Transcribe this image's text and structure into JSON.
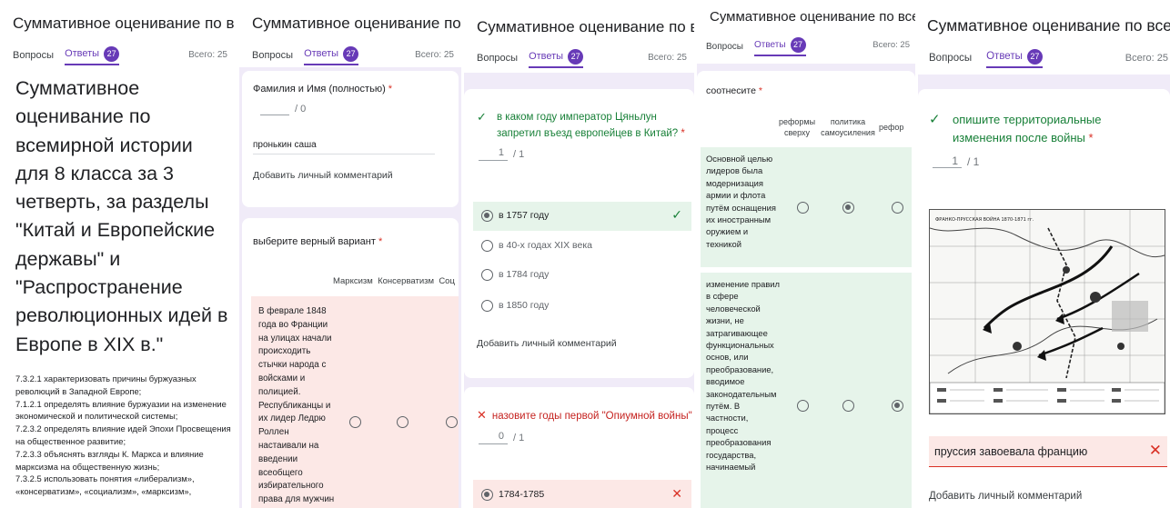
{
  "form": {
    "title": "Суммативное оценивание по всемирн",
    "tab_questions": "Вопросы",
    "tab_answers": "Ответы",
    "answers_count": "27",
    "total": "Всего: 25"
  },
  "panel1": {
    "heading": "Суммативное оценивание по всемирной истории для 8 класса за 3 четверть, за разделы \"Китай и Европейские державы\" и \"Распространение революционных идей в Европе в XIX в.\"",
    "objectives": [
      "7.3.2.1 характеризовать  причины буржуазных революций в Западной Европе;",
      "7.1.2.1 определять влияние буржуазии на изменение экономической и политической системы;",
      "7.2.3.2 определять  влияние идей Эпохи Просвещения на общественное развитие;",
      "7.2.3.3 объяснять взгляды К. Маркса и влияние марксизма на общественную жизнь;",
      "7.3.2.5 использовать понятия  «либерализм», «консерватизм», «социализм», «марксизм»,"
    ]
  },
  "panel2": {
    "q1_label": "Фамилия и Имя (полностью)",
    "q1_required": "*",
    "q1_score_max": "/ 0",
    "q1_answer": "пронькин саша",
    "q1_comment": "Добавить личный комментарий",
    "q2_label": "выберите верный вариант",
    "q2_required": "*",
    "q2_columns": [
      "Марксизм",
      "Консерватизм",
      "Соц"
    ],
    "q2_row_text": "В феврале 1848 года во Франции на улицах начали происходить стычки народа с войсками и полицией. Республиканцы и их лидер Ледрю Роллен настаивали на введении всеобщего избирательного права для мужчин"
  },
  "panel3": {
    "check_mark": "✓",
    "cross_mark": "✕",
    "q1_text": "в каком году император Цяньлун запретил въезд европейцев в Китай?",
    "q1_required": "*",
    "q1_score": "1",
    "q1_score_max": "/ 1",
    "q1_options": [
      "в 1757 году",
      "в 40-х годах XIX века",
      "в 1784 году",
      "в 1850 году"
    ],
    "q1_comment": "Добавить личный комментарий",
    "q2_text": "назовите годы первой \"Опиумной войны\"",
    "q2_required": "*",
    "q2_score": "0",
    "q2_score_max": "/ 1",
    "q2_option": "1784-1785"
  },
  "panel4": {
    "q_label": "соотнесите",
    "q_required": "*",
    "columns": [
      "реформы сверху",
      "политика самоусиления",
      "рефор"
    ],
    "row1": "Основной целью лидеров была модернизация армии и флота путём оснащения их иностранным оружием и техникой",
    "row2": "изменение правил в сфере человеческой жизни, не затрагивающее функциональных основ, или преобразование, вводимое законодательным путём. В частности, процесс преобразования государства, начинаемый"
  },
  "panel5": {
    "check_mark": "✓",
    "cross_mark": "✕",
    "q_text": "опишите территориальные изменения после войны",
    "q_required": "*",
    "score": "1",
    "score_max": "/ 1",
    "map_title": "ФРАНКО-ПРУССКАЯ ВОЙНА 1870-1871 гг.",
    "answer": "пруссия  завоевала  францию",
    "comment": "Добавить личный комментарий"
  },
  "colors": {
    "accent": "#673ab7",
    "correct_bg": "#e6f4ea",
    "incorrect_bg": "#fce8e6",
    "correct": "#188038",
    "incorrect": "#d93025"
  }
}
